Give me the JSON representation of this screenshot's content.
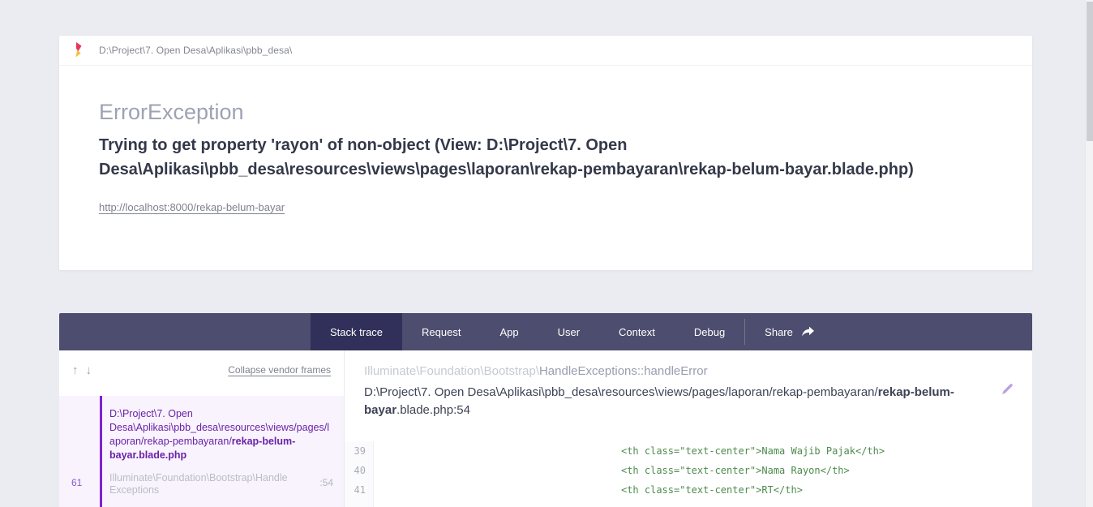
{
  "header_card": {
    "app_path": "D:\\Project\\7. Open Desa\\Aplikasi\\pbb_desa\\",
    "exception_class": "ErrorException",
    "message": "Trying to get property 'rayon' of non-object (View: D:\\Project\\7. Open Desa\\Aplikasi\\pbb_desa\\resources\\views\\pages\\laporan\\rekap-pembayaran\\rekap-belum-bayar.blade.php)",
    "url": "http://localhost:8000/rekap-belum-bayar"
  },
  "nav": {
    "tabs": [
      {
        "label": "Stack trace"
      },
      {
        "label": "Request"
      },
      {
        "label": "App"
      },
      {
        "label": "User"
      },
      {
        "label": "Context"
      },
      {
        "label": "Debug"
      }
    ],
    "share_label": "Share",
    "bar_color": "#4d4d6f",
    "active_tab_color": "#30305a"
  },
  "sidebar": {
    "collapse_link": "Collapse vendor frames",
    "frame": {
      "index": "61",
      "path_prefix": "D:\\Project\\7. Open Desa\\Aplikasi\\pbb_desa\\resources\\views/pages/laporan/rekap-pembayaran/",
      "path_file": "rekap-belum-bayar.blade.php",
      "class_name": "Illuminate\\Foundation\\Bootstrap\\HandleExceptions",
      "line_ref": ":54",
      "accent_color": "#7e22ce"
    }
  },
  "main": {
    "method_prefix": "Illuminate\\Foundation\\Bootstrap\\",
    "method_name": "HandleExceptions::handleError",
    "file_prefix": "D:\\Project\\7. Open Desa\\Aplikasi\\pbb_desa\\resources\\views/pages/laporan/rekap-pembayaran/",
    "file_bold": "rekap-belum-bayar",
    "file_suffix": ".blade.php:54",
    "code": {
      "color": "#4e8b4e",
      "lines": [
        {
          "number": "39",
          "code": "                                        <th class=\"text-center\">Nama Wajib Pajak</th>"
        },
        {
          "number": "40",
          "code": "                                        <th class=\"text-center\">Nama Rayon</th>"
        },
        {
          "number": "41",
          "code": "                                        <th class=\"text-center\">RT</th>"
        }
      ]
    }
  }
}
